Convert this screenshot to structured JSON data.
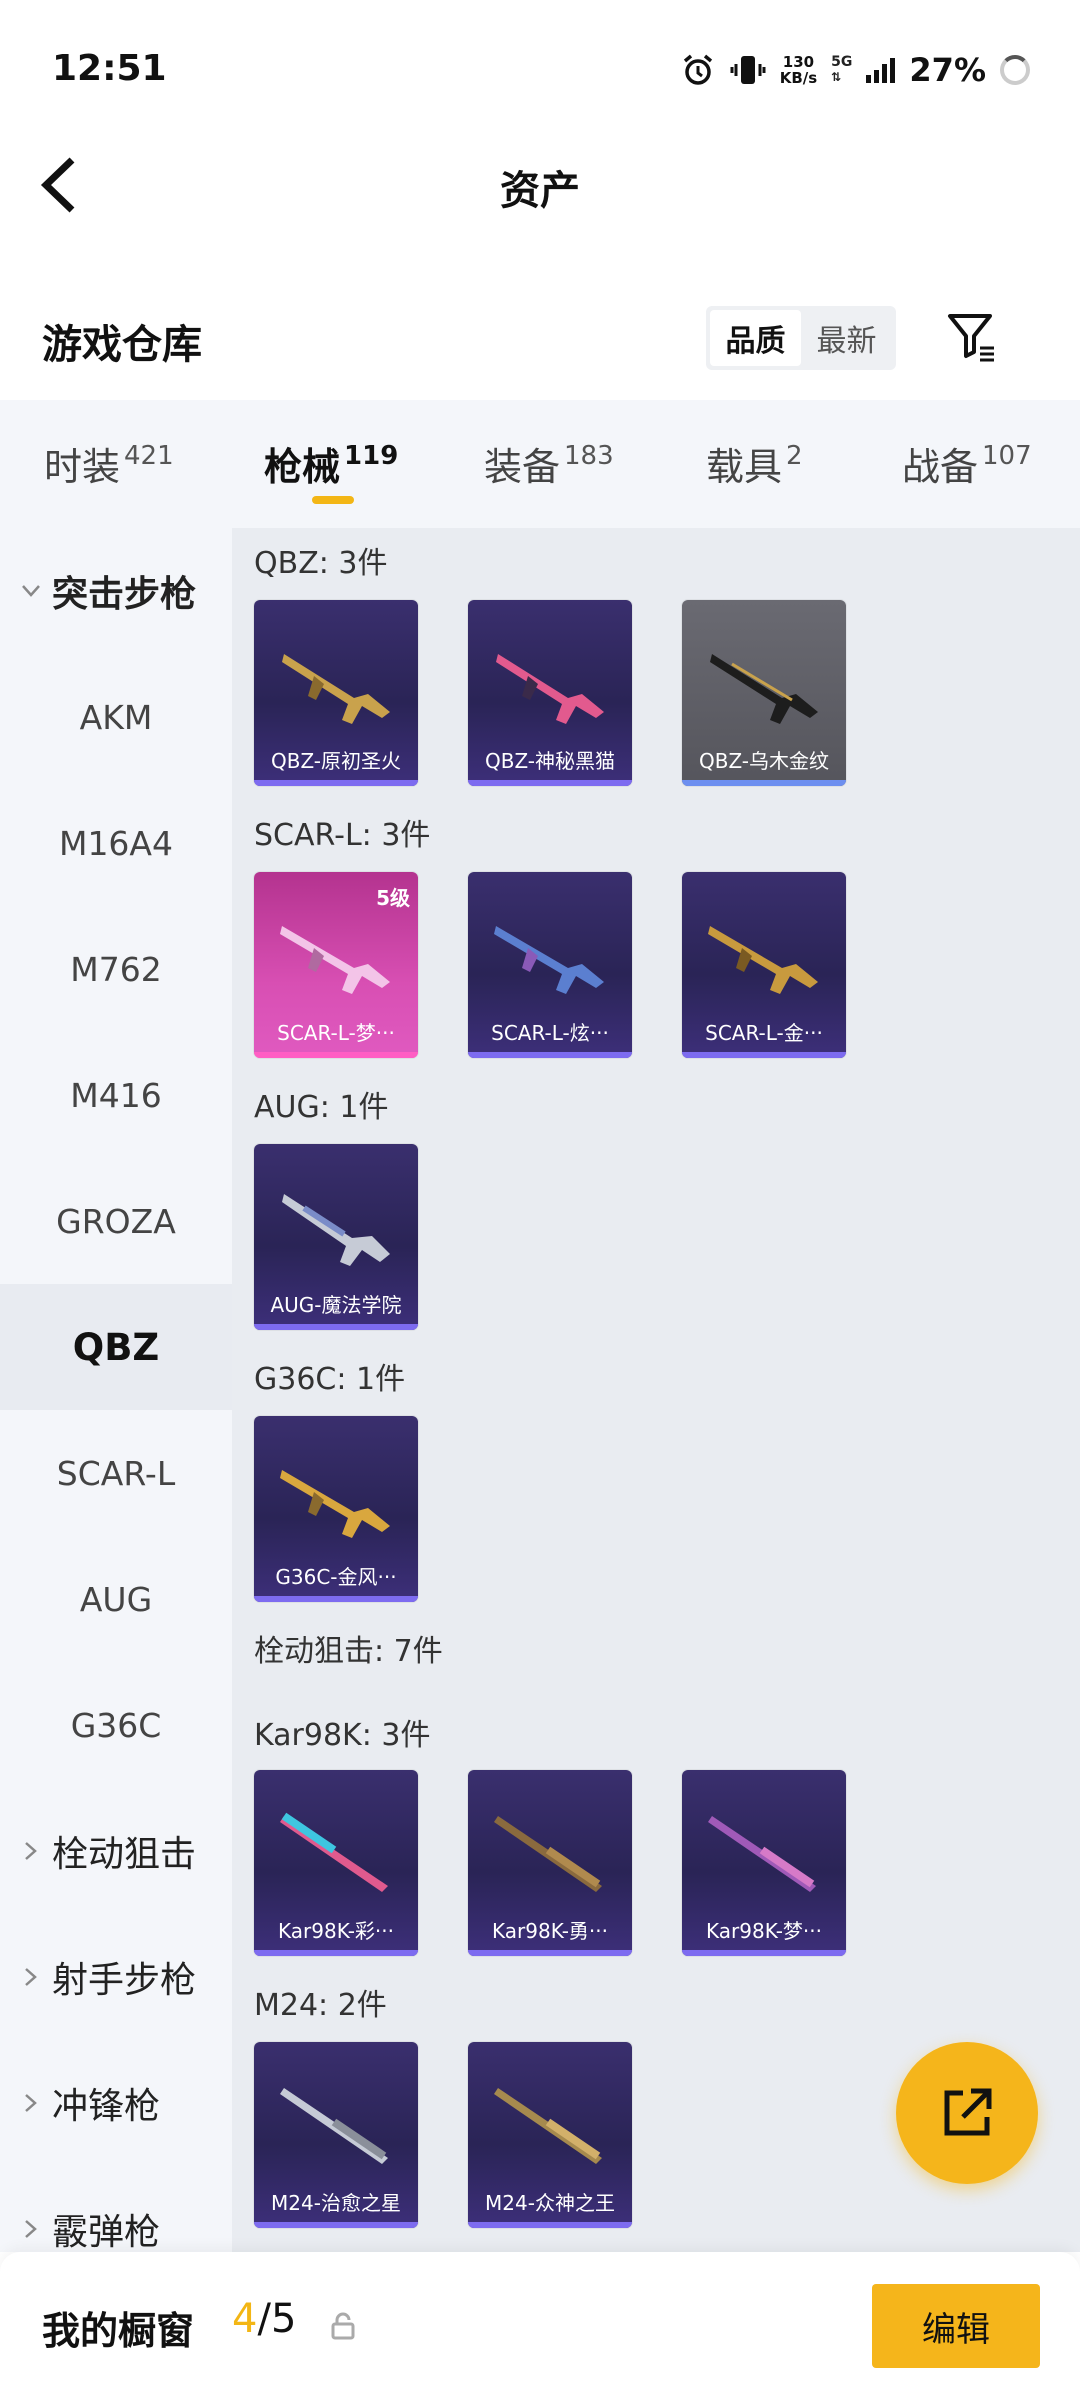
{
  "status_bar": {
    "time": "12:51",
    "net_speed_value": "130",
    "net_speed_unit": "KB/s",
    "network": "5G",
    "battery": "27%"
  },
  "header": {
    "title": "资产"
  },
  "warehouse": {
    "title": "游戏仓库",
    "sort_options": [
      "品质",
      "最新"
    ],
    "sort_selected": "品质"
  },
  "tabs": [
    {
      "label": "时装",
      "count": "421"
    },
    {
      "label": "枪械",
      "count": "119",
      "active": true
    },
    {
      "label": "装备",
      "count": "183"
    },
    {
      "label": "载具",
      "count": "2"
    },
    {
      "label": "战备",
      "count": "107"
    }
  ],
  "sidebar": {
    "items": [
      {
        "label": "突击步枪",
        "type": "group-expanded"
      },
      {
        "label": "AKM"
      },
      {
        "label": "M16A4"
      },
      {
        "label": "M762"
      },
      {
        "label": "M416"
      },
      {
        "label": "GROZA"
      },
      {
        "label": "QBZ",
        "selected": true
      },
      {
        "label": "SCAR-L"
      },
      {
        "label": "AUG"
      },
      {
        "label": "G36C"
      },
      {
        "label": "栓动狙击",
        "type": "group-collapsed"
      },
      {
        "label": "射手步枪",
        "type": "group-collapsed"
      },
      {
        "label": "冲锋枪",
        "type": "group-collapsed"
      },
      {
        "label": "霰弹枪",
        "type": "group-collapsed"
      }
    ]
  },
  "sections": [
    {
      "title": "QBZ: 3件",
      "items": [
        {
          "name": "QBZ-原初圣火",
          "style": "purple"
        },
        {
          "name": "QBZ-神秘黑猫",
          "style": "purple"
        },
        {
          "name": "QBZ-乌木金纹",
          "style": "grey"
        }
      ]
    },
    {
      "title": "SCAR-L: 3件",
      "items": [
        {
          "name": "SCAR-L-梦···",
          "style": "pink",
          "badge": "5级"
        },
        {
          "name": "SCAR-L-炫···",
          "style": "purple"
        },
        {
          "name": "SCAR-L-金···",
          "style": "purple"
        }
      ]
    },
    {
      "title": "AUG: 1件",
      "items": [
        {
          "name": "AUG-魔法学院",
          "style": "purple"
        }
      ]
    },
    {
      "title": "G36C: 1件",
      "items": [
        {
          "name": "G36C-金风···",
          "style": "purple"
        }
      ]
    },
    {
      "title": "栓动狙击: 7件",
      "items": []
    },
    {
      "title": "Kar98K: 3件",
      "items": [
        {
          "name": "Kar98K-彩···",
          "style": "purple"
        },
        {
          "name": "Kar98K-勇···",
          "style": "purple"
        },
        {
          "name": "Kar98K-梦···",
          "style": "purple"
        }
      ]
    },
    {
      "title": "M24: 2件",
      "items": [
        {
          "name": "M24-治愈之星",
          "style": "purple"
        },
        {
          "name": "M24-众神之王",
          "style": "purple"
        }
      ]
    }
  ],
  "bottom_bar": {
    "label": "我的橱窗",
    "current": "4",
    "separator": "/",
    "total": "5",
    "edit_label": "编辑"
  },
  "colors": {
    "accent": "#f5b51b",
    "tab_underline": "#f3b615",
    "card_purple": "#2a2456",
    "card_pink": "#d84fb3"
  }
}
